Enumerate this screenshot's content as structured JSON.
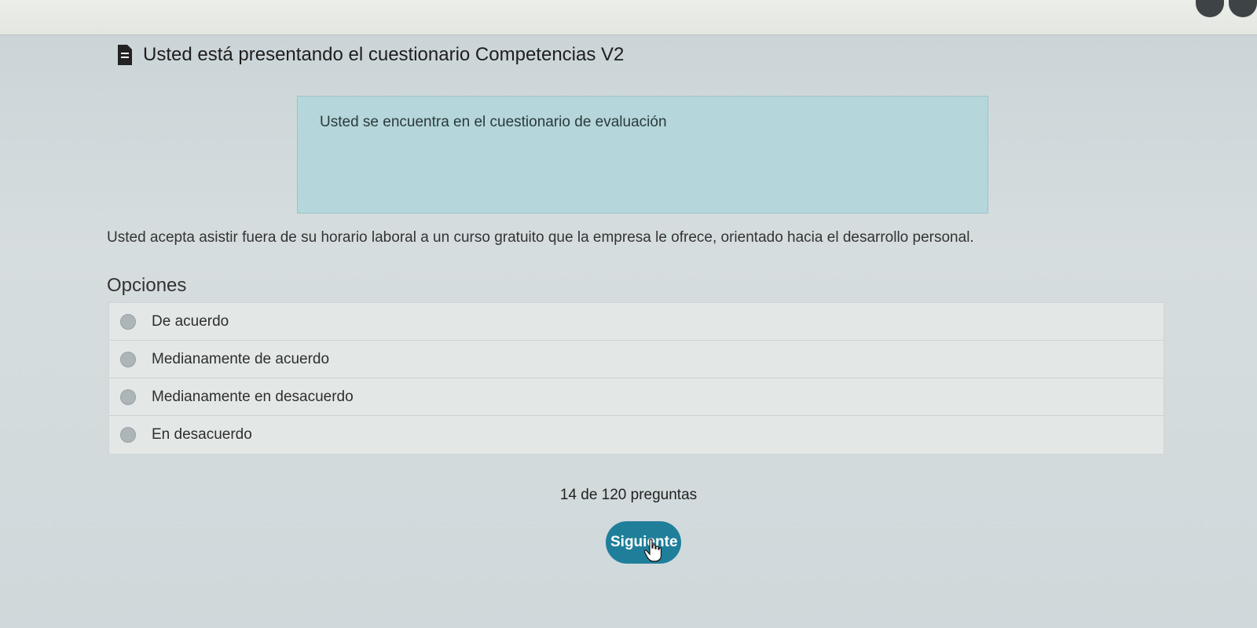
{
  "header": {
    "icon": "document-icon",
    "title": "Usted está presentando el cuestionario Competencias V2"
  },
  "alert": {
    "text": "Usted se encuentra en el cuestionario de evaluación"
  },
  "question": {
    "text": "Usted acepta asistir fuera de su horario laboral a un curso gratuito que la empresa le ofrece, orientado hacia el desarrollo personal."
  },
  "options": {
    "label": "Opciones",
    "items": [
      {
        "label": "De acuerdo"
      },
      {
        "label": "Medianamente de acuerdo"
      },
      {
        "label": "Medianamente en desacuerdo"
      },
      {
        "label": "En desacuerdo"
      }
    ]
  },
  "progress": {
    "text": "14 de 120 preguntas"
  },
  "actions": {
    "next_label": "Siguiente"
  },
  "colors": {
    "button": "#1f7f9a",
    "alert_bg": "#b5d6da"
  }
}
